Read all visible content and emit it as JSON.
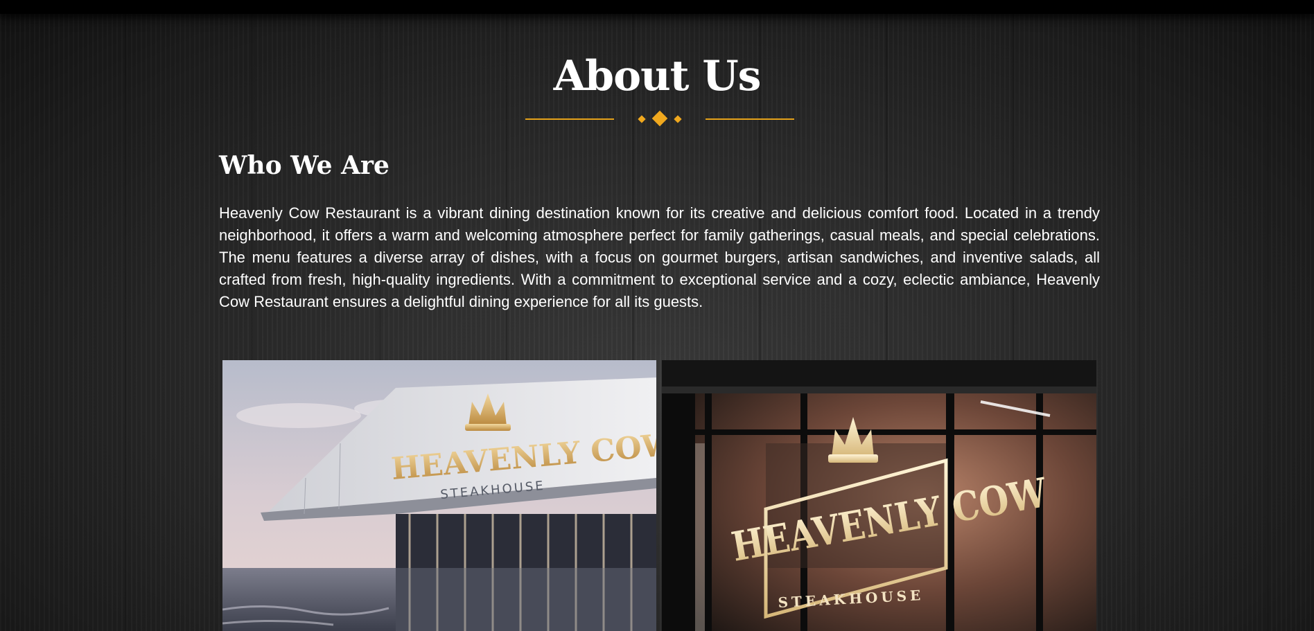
{
  "page": {
    "title": "About Us",
    "accent_color": "#f0a81e"
  },
  "section": {
    "heading": "Who We Are",
    "paragraph": "Heavenly Cow Restaurant is a vibrant dining destination known for its creative and delicious comfort food. Located in a trendy neighborhood, it offers a warm and welcoming atmosphere perfect for family gatherings, casual meals, and special celebrations. The menu features a diverse array of dishes, with a focus on gourmet burgers, artisan sandwiches, and inventive salads, all crafted from fresh, high-quality ingredients. With a commitment to exceptional service and a cozy, eclectic ambiance, Heavenly Cow Restaurant ensures a delightful dining experience for all its guests."
  },
  "gallery": [
    {
      "sign_name": "HEAVENLY COW",
      "sign_sub": "STEAKHOUSE"
    },
    {
      "sign_name": "HEAVENLY COW",
      "sign_sub": "STEAKHOUSE"
    }
  ]
}
